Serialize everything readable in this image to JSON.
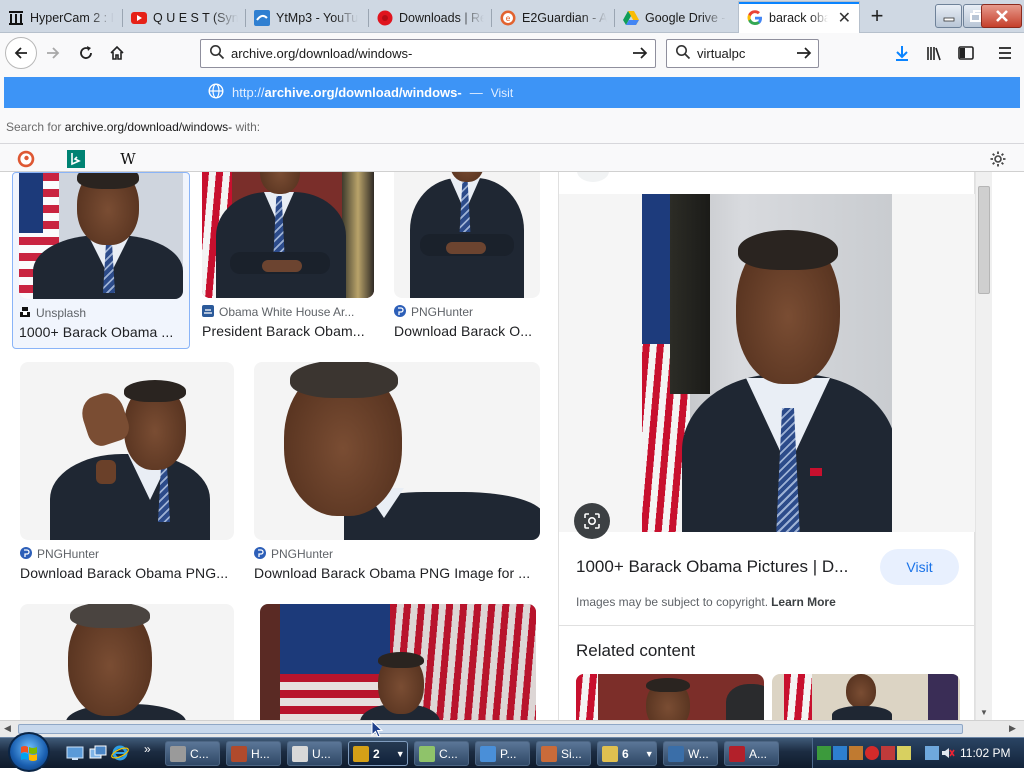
{
  "browser": {
    "tabs": [
      {
        "title": "HyperCam 2 : I",
        "icon": "archive-icon",
        "active": false
      },
      {
        "title": "Q U E S T (Synt",
        "icon": "youtube-icon",
        "active": false
      },
      {
        "title": "YtMp3 - YouTu",
        "icon": "ytmp3-icon",
        "active": false
      },
      {
        "title": "Downloads | Re",
        "icon": "red-circle-icon",
        "active": false
      },
      {
        "title": "E2Guardian - A",
        "icon": "e2guardian-icon",
        "active": false
      },
      {
        "title": "Google Drive -",
        "icon": "google-drive-icon",
        "active": false
      },
      {
        "title": "barack oba",
        "icon": "google-icon",
        "active": true
      }
    ],
    "new_tab_label": "+",
    "url_value": "archive.org/download/windows-",
    "search_value": "virtualpc",
    "suggestion": {
      "proto": "http://",
      "host_path": "archive.org/download/windows-",
      "dash": "—",
      "action": "Visit"
    },
    "search_for_prefix": "Search for ",
    "search_for_query": "archive.org/download/windows-",
    "search_for_suffix": " with:",
    "one_off_engines": [
      "duckduckgo-icon",
      "bing-icon",
      "wikipedia-icon"
    ],
    "wikipedia_glyph": "W"
  },
  "results": {
    "row1": [
      {
        "source": "Unsplash",
        "caption": "1000+ Barack Obama ...",
        "icon": "unsplash-icon"
      },
      {
        "source": "Obama White House Ar...",
        "caption": "President Barack Obam...",
        "icon": "obama-wh-icon"
      },
      {
        "source": "PNGHunter",
        "caption": "Download Barack O...",
        "icon": "pnghunter-icon"
      }
    ],
    "row2": [
      {
        "source": "PNGHunter",
        "caption": "Download Barack Obama PNG...",
        "icon": "pnghunter-icon"
      },
      {
        "source": "PNGHunter",
        "caption": "Download Barack Obama PNG Image for ...",
        "icon": "pnghunter-icon"
      }
    ]
  },
  "preview": {
    "title": "1000+ Barack Obama Pictures | D...",
    "visit_label": "Visit",
    "copyright_text": "Images may be subject to copyright.",
    "learn_more": "Learn More",
    "related_heading": "Related content"
  },
  "taskbar": {
    "items": [
      {
        "label": "C...",
        "color": "#9a9a9a"
      },
      {
        "label": "H...",
        "color": "#b04a2c"
      },
      {
        "label": "U...",
        "color": "#d8d8d8"
      },
      {
        "label": "2",
        "color": "#d4a017",
        "active": true
      },
      {
        "label": "C...",
        "color": "#8fc36a"
      },
      {
        "label": "P...",
        "color": "#4a8fd8"
      },
      {
        "label": "Si...",
        "color": "#c96b3a"
      },
      {
        "label": "6",
        "color": "#e0c050"
      },
      {
        "label": "W...",
        "color": "#3a6ea8"
      },
      {
        "label": "A...",
        "color": "#b3202a"
      }
    ],
    "clock": "11:02 PM"
  },
  "colors": {
    "accent": "#0a84ff",
    "suggestion_bg": "#3d94f6",
    "google_blue": "#1a73e8"
  }
}
